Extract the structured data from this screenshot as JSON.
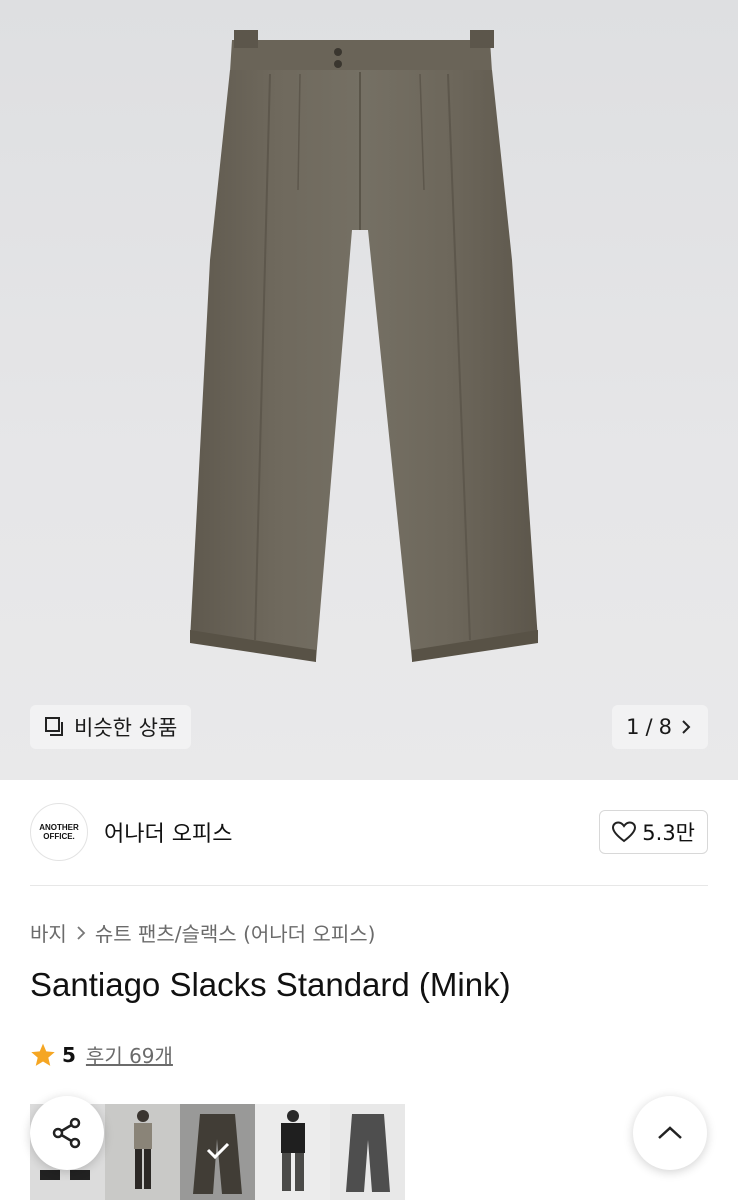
{
  "hero": {
    "image_alt": "Santiago Slacks Standard (Mink) product photo",
    "similar_label": "비슷한 상품",
    "pager": {
      "current": "1",
      "separator": "/",
      "total": "8"
    }
  },
  "brand": {
    "logo_line1": "ANOTHER",
    "logo_line2": "OFFICE.",
    "name": "어나더 오피스",
    "likes": "5.3만"
  },
  "breadcrumb": {
    "category": "바지",
    "subcategory": "슈트 팬츠/슬랙스 (어나더 오피스)"
  },
  "product": {
    "title": "Santiago Slacks Standard (Mink)"
  },
  "rating": {
    "score": "5",
    "reviews": "후기 69개",
    "star_color": "#f5a623"
  },
  "thumbnails": [
    {
      "name": "thumb-look-1"
    },
    {
      "name": "thumb-look-2"
    },
    {
      "name": "thumb-pants-mink",
      "selected": true
    },
    {
      "name": "thumb-look-3"
    },
    {
      "name": "thumb-pants-charcoal"
    }
  ],
  "icons": {
    "similar": "copy-square-icon",
    "pager_next": "chevron-right-icon",
    "like": "heart-outline-icon",
    "share": "share-icon",
    "scroll_top": "chevron-up-icon",
    "star": "star-icon"
  }
}
